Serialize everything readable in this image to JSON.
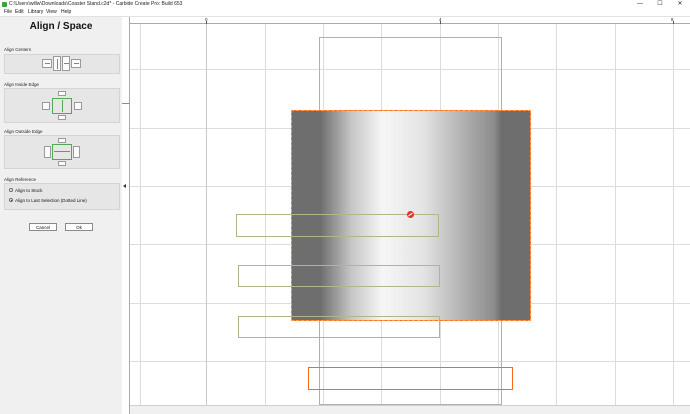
{
  "window": {
    "title": "C:\\Users\\willw\\Downloads\\Coaster Stand.c2d* - Carbide Create Pro: Build 653",
    "minimize_glyph": "—",
    "maximize_glyph": "☐",
    "close_glyph": "✕"
  },
  "menu": {
    "file": "File",
    "edit": "Edit",
    "library": "Library",
    "view": "View",
    "help": "Help"
  },
  "panel": {
    "title": "Align / Space",
    "align_centers_label": "Align Centers",
    "align_inside_label": "Align Inside Edge",
    "align_outside_label": "Align Outside Edge",
    "align_reference_label": "Align Reference",
    "align_to_stock": "Align to Stock",
    "align_to_last": "Align to Last Selection (Dotted Line)",
    "selected_reference": "last",
    "cancel_label": "Cancel",
    "ok_label": "Ok"
  },
  "ruler": {
    "tick_0": "0",
    "tick_4": "4",
    "tick_8": "8"
  },
  "colors": {
    "selection": "#ff6a13",
    "vector_outline": "#b4b48a",
    "align_button_glyph": "#53a853",
    "grid": "#dcdcdc"
  }
}
